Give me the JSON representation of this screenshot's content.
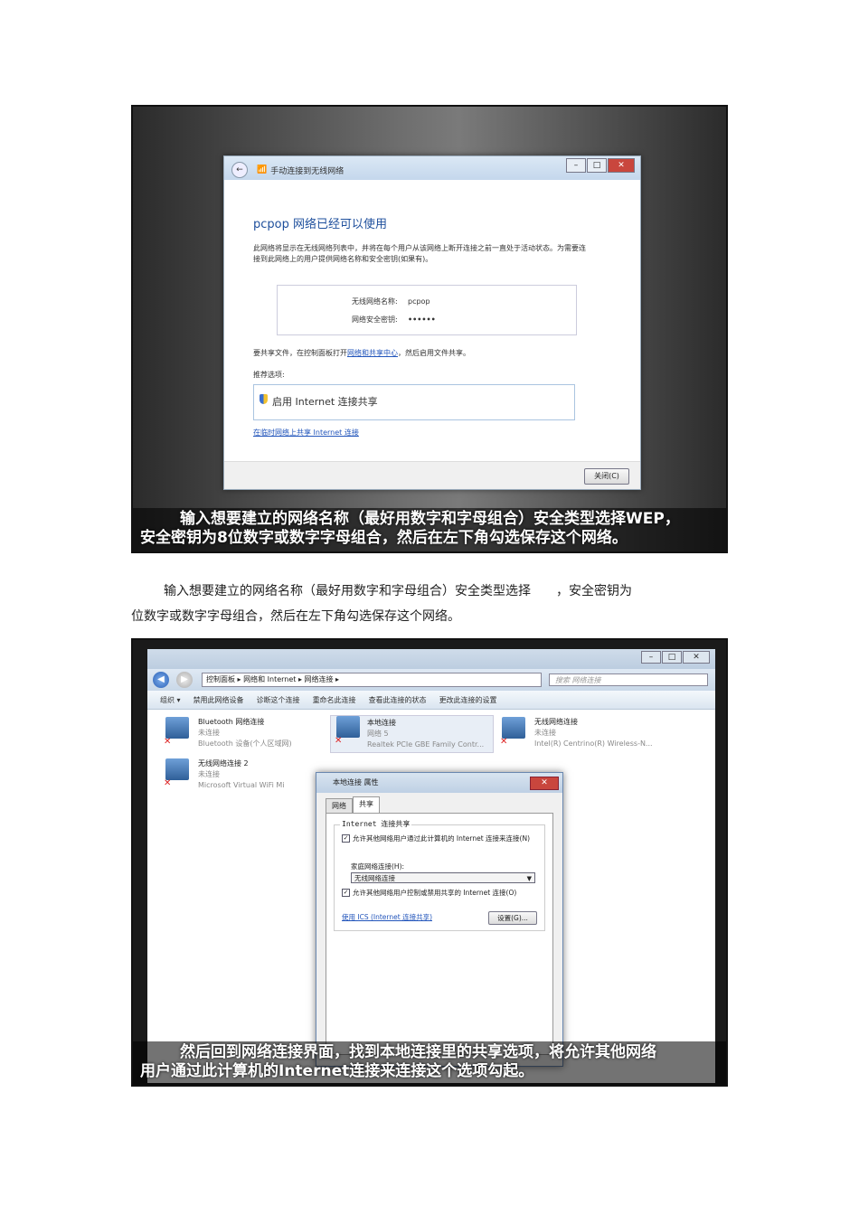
{
  "figure1": {
    "dialog_title": "手动连接到无线网络",
    "heading": "pcpop 网络已经可以使用",
    "description": "此网络将显示在无线网络列表中，并将在每个用户从该网络上断开连接之前一直处于活动状态。为需要连接到此网络上的用户提供网络名称和安全密钥(如果有)。",
    "network_name_label": "无线网络名称:",
    "network_name_value": "pcpop",
    "security_key_label": "网络安全密钥:",
    "security_key_value": "••••••",
    "share_text_before": "要共享文件，在控制面板打开",
    "share_link": "网络和共享中心",
    "share_text_after": "，然后启用文件共享。",
    "recommended_label": "推荐选项:",
    "recommended_option": "启用 Internet 连接共享",
    "bottom_link": "在临时网络上共享 Internet 连接",
    "close_button": "关闭(C)",
    "caption_line1": "输入想要建立的网络名称（最好用数字和字母组合）安全类型选择WEP，",
    "caption_line2": "安全密钥为8位数字或数字字母组合，然后在左下角勾选保存这个网络。"
  },
  "paragraph": {
    "line1": "输入想要建立的网络名称（最好用数字和字母组合）安全类型选择　　，安全密钥为",
    "line2": "位数字或数字字母组合，然后在左下角勾选保存这个网络。"
  },
  "figure2": {
    "address_path": "控制面板 ▸ 网络和 Internet ▸ 网络连接 ▸",
    "search_placeholder": "搜索 网络连接",
    "toolbar": [
      "组织 ▾",
      "禁用此网络设备",
      "诊断这个连接",
      "重命名此连接",
      "查看此连接的状态",
      "更改此连接的设置"
    ],
    "connections": [
      {
        "name": "Bluetooth 网络连接",
        "status": "未连接",
        "device": "Bluetooth 设备(个人区域网)"
      },
      {
        "name": "本地连接",
        "status": "网络 5",
        "device": "Realtek PCIe GBE Family Contr..."
      },
      {
        "name": "无线网络连接",
        "status": "未连接",
        "device": "Intel(R) Centrino(R) Wireless-N..."
      },
      {
        "name": "无线网络连接 2",
        "status": "未连接",
        "device": "Microsoft Virtual WiFi Mi"
      }
    ],
    "props_title": "本地连接 属性",
    "tab_network": "网络",
    "tab_sharing": "共享",
    "group_label": "Internet 连接共享",
    "check1": "允许其他网络用户通过此计算机的 Internet 连接来连接(N)",
    "home_label": "家庭网络连接(H):",
    "home_select": "无线网络连接",
    "check2": "允许其他网络用户控制或禁用共享的 Internet 连接(O)",
    "ics_link": "使用 ICS (Internet 连接共享)",
    "settings_button": "设置(G)...",
    "caption_line1": "然后回到网络连接界面，找到本地连接里的共享选项，将允许其他网络",
    "caption_line2": "用户通过此计算机的Internet连接来连接这个选项勾起。"
  }
}
